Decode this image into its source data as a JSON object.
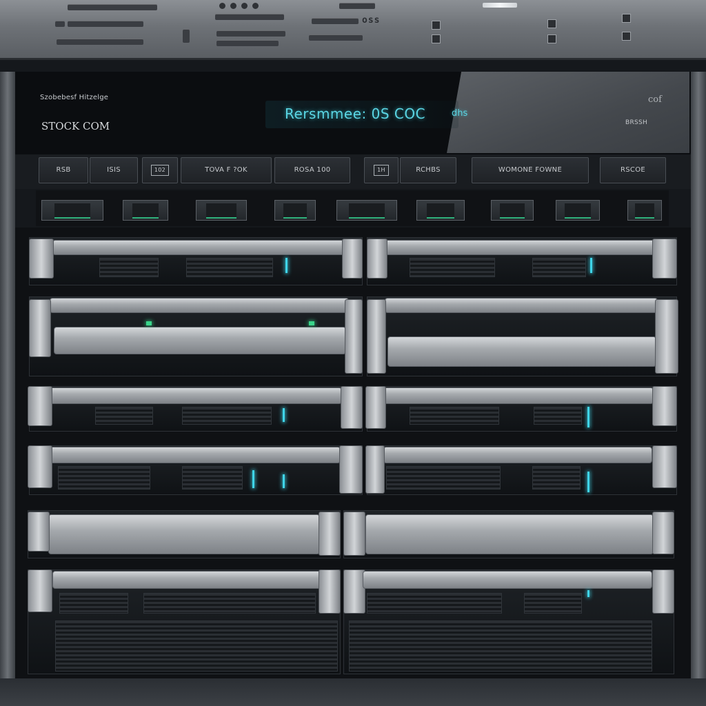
{
  "display": {
    "brand_small": "Szobebesf Hitzelge",
    "brand_large": "STOCK COM",
    "lcd_text": "Rersmmee:  0S  COC",
    "lcd_suffix": "dhs",
    "code_right": "cof",
    "sub_right": "BRSSH"
  },
  "plate": {
    "code_text": "oss"
  },
  "labels": [
    "RSB",
    "ISIS",
    "102",
    "TOVA F  ?OK",
    "ROSA  100",
    "1H",
    "RCHBS",
    "WOMONE FOWNE",
    "RSCOE"
  ],
  "leds": {
    "color": "#3fd4e8",
    "accent_green": "#39d48a"
  }
}
